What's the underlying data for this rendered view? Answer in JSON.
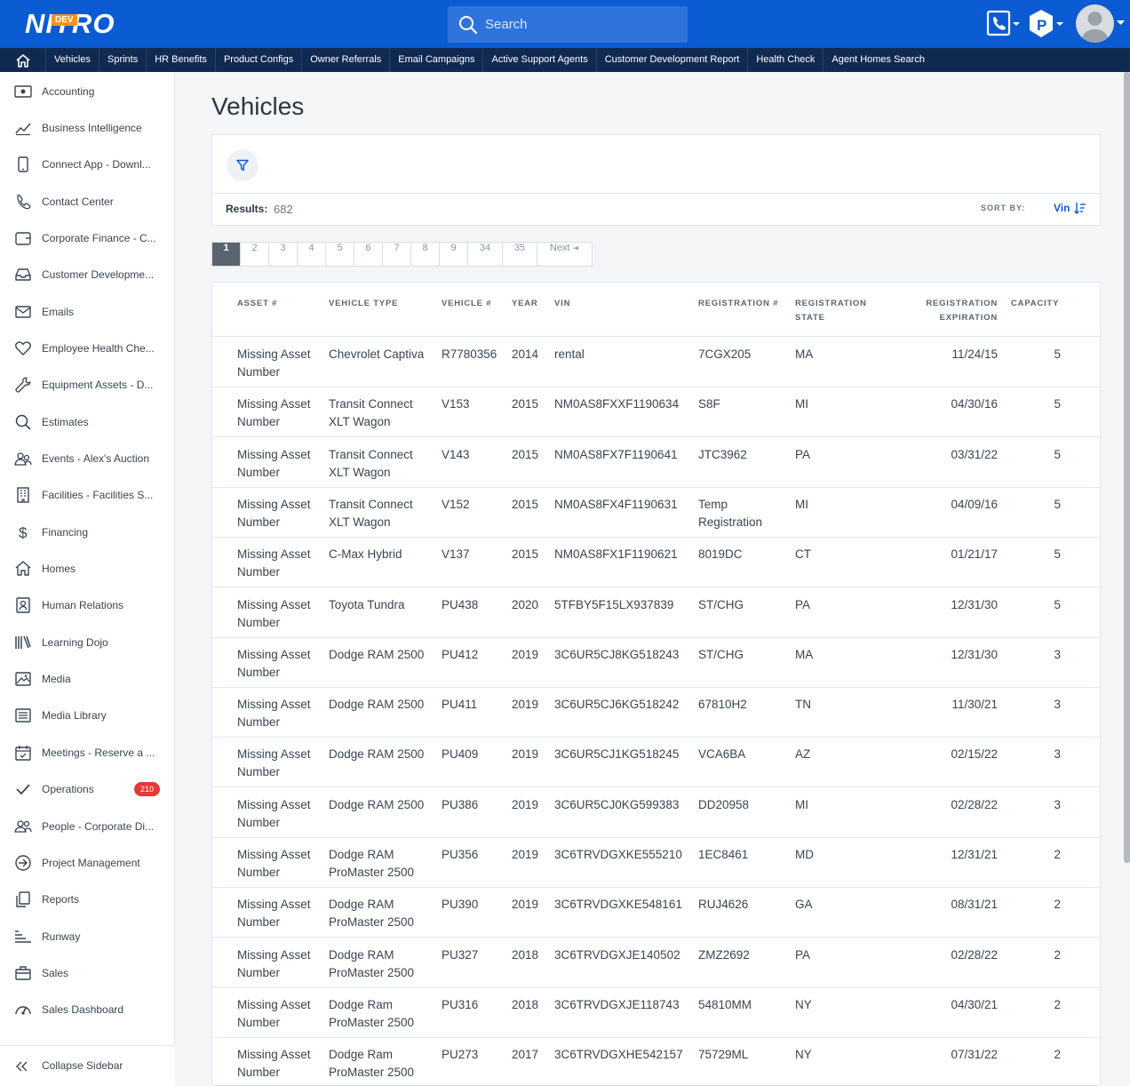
{
  "app": {
    "logo_text": "NITRO",
    "env_badge": "DEV",
    "search_placeholder": "Search"
  },
  "navbar": {
    "links": [
      "Vehicles",
      "Sprints",
      "HR Benefits",
      "Product Configs",
      "Owner Referrals",
      "Email Campaigns",
      "Active Support Agents",
      "Customer Development Report",
      "Health Check",
      "Agent Homes Search"
    ]
  },
  "sidebar": {
    "items": [
      {
        "label": "Accounting",
        "icon": "cash-icon"
      },
      {
        "label": "Business Intelligence",
        "icon": "chart-icon"
      },
      {
        "label": "Connect App - Downl...",
        "icon": "mobile-icon"
      },
      {
        "label": "Contact Center",
        "icon": "phone-icon"
      },
      {
        "label": "Corporate Finance - C...",
        "icon": "wallet-icon"
      },
      {
        "label": "Customer Developme...",
        "icon": "inbox-icon"
      },
      {
        "label": "Emails",
        "icon": "mail-icon"
      },
      {
        "label": "Employee Health Che...",
        "icon": "heart-icon"
      },
      {
        "label": "Equipment Assets - D...",
        "icon": "wrench-icon"
      },
      {
        "label": "Estimates",
        "icon": "search-icon"
      },
      {
        "label": "Events - Alex's Auction",
        "icon": "people-icon"
      },
      {
        "label": "Facilities - Facilities S...",
        "icon": "building-icon"
      },
      {
        "label": "Financing",
        "icon": "dollar-icon"
      },
      {
        "label": "Homes",
        "icon": "home-icon"
      },
      {
        "label": "Human Relations",
        "icon": "contact-icon"
      },
      {
        "label": "Learning Dojo",
        "icon": "books-icon"
      },
      {
        "label": "Media",
        "icon": "image-icon"
      },
      {
        "label": "Media Library",
        "icon": "list-icon"
      },
      {
        "label": "Meetings - Reserve a ...",
        "icon": "calendar-icon"
      },
      {
        "label": "Operations",
        "icon": "check-icon",
        "badge": "210"
      },
      {
        "label": "People - Corporate Di...",
        "icon": "users-icon"
      },
      {
        "label": "Project Management",
        "icon": "arrow-circle-icon"
      },
      {
        "label": "Reports",
        "icon": "copy-icon"
      },
      {
        "label": "Runway",
        "icon": "runway-icon"
      },
      {
        "label": "Sales",
        "icon": "briefcase-icon"
      },
      {
        "label": "Sales Dashboard",
        "icon": "gauge-icon"
      }
    ],
    "collapse_label": "Collapse Sidebar"
  },
  "page": {
    "title": "Vehicles",
    "results_label": "Results:",
    "results_count": "682",
    "sort_by_label": "SORT BY:",
    "sort_by_value": "Vin"
  },
  "pagination": {
    "pages": [
      "1",
      "2",
      "3",
      "4",
      "5",
      "6",
      "7",
      "8",
      "9",
      "34",
      "35"
    ],
    "next_label": "Next",
    "active": "1"
  },
  "table": {
    "columns": [
      {
        "key": "asset",
        "label": "ASSET #"
      },
      {
        "key": "type",
        "label": "VEHICLE TYPE"
      },
      {
        "key": "vehicle",
        "label": "VEHICLE #"
      },
      {
        "key": "year",
        "label": "YEAR"
      },
      {
        "key": "vin",
        "label": "VIN"
      },
      {
        "key": "reg",
        "label": "REGISTRATION #"
      },
      {
        "key": "state",
        "label": "REGISTRATION STATE"
      },
      {
        "key": "exp",
        "label": "REGISTRATION EXPIRATION"
      },
      {
        "key": "cap",
        "label": "CAPACITY"
      }
    ],
    "rows": [
      {
        "asset": "Missing Asset Number",
        "type": "Chevrolet Captiva",
        "vehicle": "R7780356",
        "year": "2014",
        "vin": "rental",
        "reg": "7CGX205",
        "state": "MA",
        "exp": "11/24/15",
        "cap": "5"
      },
      {
        "asset": "Missing Asset Number",
        "type": "Transit Connect XLT Wagon",
        "vehicle": "V153",
        "year": "2015",
        "vin": "NM0AS8FXXF1190634",
        "reg": "S8F",
        "state": "MI",
        "exp": "04/30/16",
        "cap": "5"
      },
      {
        "asset": "Missing Asset Number",
        "type": "Transit Connect XLT Wagon",
        "vehicle": "V143",
        "year": "2015",
        "vin": "NM0AS8FX7F1190641",
        "reg": "JTC3962",
        "state": "PA",
        "exp": "03/31/22",
        "cap": "5"
      },
      {
        "asset": "Missing Asset Number",
        "type": "Transit Connect XLT Wagon",
        "vehicle": "V152",
        "year": "2015",
        "vin": "NM0AS8FX4F1190631",
        "reg": "Temp Registration",
        "state": "MI",
        "exp": "04/09/16",
        "cap": "5"
      },
      {
        "asset": "Missing Asset Number",
        "type": "C-Max Hybrid",
        "vehicle": "V137",
        "year": "2015",
        "vin": "NM0AS8FX1F1190621",
        "reg": "8019DC",
        "state": "CT",
        "exp": "01/21/17",
        "cap": "5"
      },
      {
        "asset": "Missing Asset Number",
        "type": "Toyota Tundra",
        "vehicle": "PU438",
        "year": "2020",
        "vin": "5TFBY5F15LX937839",
        "reg": "ST/CHG",
        "state": "PA",
        "exp": "12/31/30",
        "cap": "5"
      },
      {
        "asset": "Missing Asset Number",
        "type": "Dodge RAM 2500",
        "vehicle": "PU412",
        "year": "2019",
        "vin": "3C6UR5CJ8KG518243",
        "reg": "ST/CHG",
        "state": "MA",
        "exp": "12/31/30",
        "cap": "3"
      },
      {
        "asset": "Missing Asset Number",
        "type": "Dodge RAM 2500",
        "vehicle": "PU411",
        "year": "2019",
        "vin": "3C6UR5CJ6KG518242",
        "reg": "67810H2",
        "state": "TN",
        "exp": "11/30/21",
        "cap": "3"
      },
      {
        "asset": "Missing Asset Number",
        "type": "Dodge RAM 2500",
        "vehicle": "PU409",
        "year": "2019",
        "vin": "3C6UR5CJ1KG518245",
        "reg": "VCA6BA",
        "state": "AZ",
        "exp": "02/15/22",
        "cap": "3"
      },
      {
        "asset": "Missing Asset Number",
        "type": "Dodge RAM 2500",
        "vehicle": "PU386",
        "year": "2019",
        "vin": "3C6UR5CJ0KG599383",
        "reg": "DD20958",
        "state": "MI",
        "exp": "02/28/22",
        "cap": "3"
      },
      {
        "asset": "Missing Asset Number",
        "type": "Dodge RAM ProMaster 2500",
        "vehicle": "PU356",
        "year": "2019",
        "vin": "3C6TRVDGXKE555210",
        "reg": "1EC8461",
        "state": "MD",
        "exp": "12/31/21",
        "cap": "2"
      },
      {
        "asset": "Missing Asset Number",
        "type": "Dodge RAM ProMaster 2500",
        "vehicle": "PU390",
        "year": "2019",
        "vin": "3C6TRVDGXKE548161",
        "reg": "RUJ4626",
        "state": "GA",
        "exp": "08/31/21",
        "cap": "2"
      },
      {
        "asset": "Missing Asset Number",
        "type": "Dodge RAM ProMaster 2500",
        "vehicle": "PU327",
        "year": "2018",
        "vin": "3C6TRVDGXJE140502",
        "reg": "ZMZ2692",
        "state": "PA",
        "exp": "02/28/22",
        "cap": "2"
      },
      {
        "asset": "Missing Asset Number",
        "type": "Dodge Ram ProMaster 2500",
        "vehicle": "PU316",
        "year": "2018",
        "vin": "3C6TRVDGXJE118743",
        "reg": "54810MM",
        "state": "NY",
        "exp": "04/30/21",
        "cap": "2"
      },
      {
        "asset": "Missing Asset Number",
        "type": "Dodge Ram ProMaster 2500",
        "vehicle": "PU273",
        "year": "2017",
        "vin": "3C6TRVDGXHE542157",
        "reg": "75729ML",
        "state": "NY",
        "exp": "07/31/22",
        "cap": "2"
      }
    ]
  },
  "colors": {
    "brand_blue": "#0b5bd3",
    "nav_dark": "#102a52",
    "badge_red": "#e53935",
    "logo_orange": "#f7931e"
  }
}
